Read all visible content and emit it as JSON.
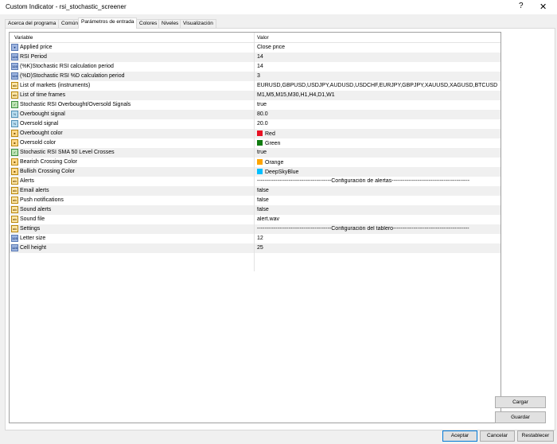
{
  "window": {
    "title": "Custom Indicator - rsi_stochastic_screener",
    "help_label": "?",
    "close_label": "✕"
  },
  "tabs": [
    {
      "label": "Acerca del programa"
    },
    {
      "label": "Común"
    },
    {
      "label": "Parámetros de entrada"
    },
    {
      "label": "Colores"
    },
    {
      "label": "Niveles"
    },
    {
      "label": "Visualización"
    }
  ],
  "active_tab": "Parámetros de entrada",
  "grid": {
    "headers": {
      "variable": "Variable",
      "value": "Valor"
    },
    "rows": [
      {
        "icon": "enum-icon",
        "name": "Applied price",
        "value": "Close price"
      },
      {
        "icon": "int-icon",
        "name": "RSI Period",
        "value": "14"
      },
      {
        "icon": "int-icon",
        "name": "(%K)Stochastic RSI calculation period",
        "value": "14"
      },
      {
        "icon": "int-icon",
        "name": "(%D)Stochastic RSI %D calculation period",
        "value": "3"
      },
      {
        "icon": "string-icon",
        "name": "List of markets (instruments)",
        "value": "EURUSD,GBPUSD,USDJPY,AUDUSD,USDCHF,EURJPY,GBPJPY,XAUUSD,XAGUSD,BTCUSD,ETH..."
      },
      {
        "icon": "string-icon",
        "name": "List of time frames",
        "value": "M1,M5,M15,M30,H1,H4,D1,W1"
      },
      {
        "icon": "bool-icon",
        "name": "Stochastic RSI Overbought/Oversold Signals",
        "value": "true"
      },
      {
        "icon": "double-icon",
        "name": "Overbought signal",
        "value": "80.0"
      },
      {
        "icon": "double-icon",
        "name": "Oversold signal",
        "value": "20.0"
      },
      {
        "icon": "color-icon",
        "name": "Overbought color",
        "value": "Red",
        "swatch": "#e81123"
      },
      {
        "icon": "color-icon",
        "name": "Oversold color",
        "value": "Green",
        "swatch": "#107c10"
      },
      {
        "icon": "bool-icon",
        "name": "Stochastic RSI SMA 50 Level Crosses",
        "value": "true"
      },
      {
        "icon": "color-icon",
        "name": "Bearish Crossing Color",
        "value": "Orange",
        "swatch": "#ffa500"
      },
      {
        "icon": "color-icon",
        "name": "Bullish Crossing Color",
        "value": "DeepSkyBlue",
        "swatch": "#00bfff"
      },
      {
        "icon": "string-icon",
        "name": "Alerts",
        "value": "----------------------------------------Configuración de alertas------------------------------------------"
      },
      {
        "icon": "string-icon",
        "name": "Email alerts",
        "value": "false"
      },
      {
        "icon": "string-icon",
        "name": "Push notifications",
        "value": "false"
      },
      {
        "icon": "string-icon",
        "name": "Sound alerts",
        "value": "false"
      },
      {
        "icon": "string-icon",
        "name": "Sound file",
        "value": "alert.wav"
      },
      {
        "icon": "string-icon",
        "name": "Settings",
        "value": "----------------------------------------Configuración del tablero-----------------------------------------"
      },
      {
        "icon": "int-icon",
        "name": "Letter size",
        "value": "12"
      },
      {
        "icon": "int-icon",
        "name": "Cell height",
        "value": "25"
      }
    ]
  },
  "side_buttons": {
    "load": "Cargar",
    "save": "Guardar"
  },
  "bottom_buttons": {
    "accept": "Aceptar",
    "cancel": "Cancelar",
    "reset": "Restablecer"
  }
}
